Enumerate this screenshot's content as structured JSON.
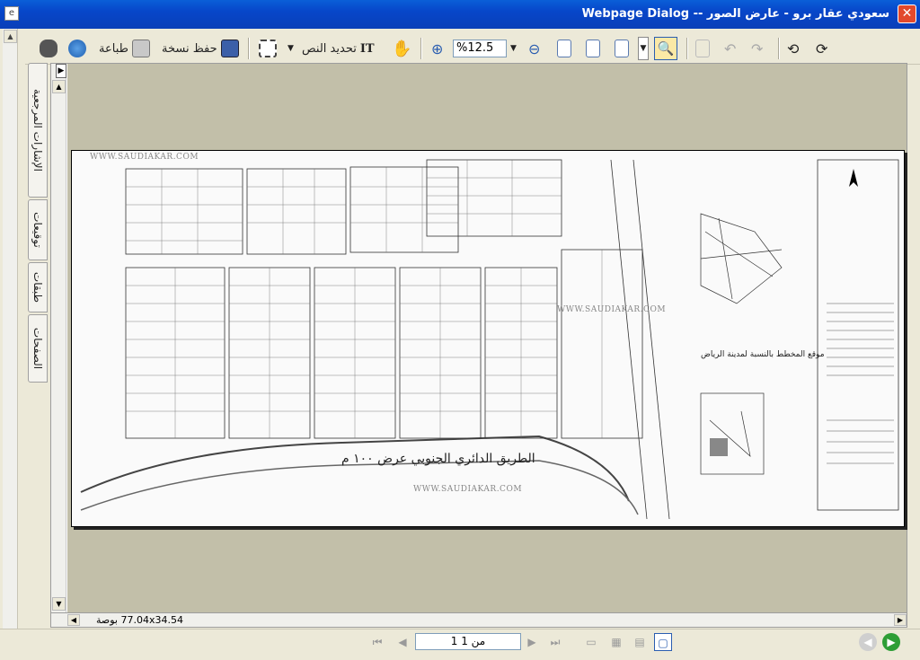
{
  "window": {
    "title": "سعودي عقار برو - عارض الصور -- Webpage Dialog",
    "close_label": "✕"
  },
  "toolbar": {
    "print_label": "طباعة",
    "save_copy_label": "حفظ نسخة",
    "select_text_label": "تحديد النص",
    "zoom_value": "%12.5"
  },
  "side_tabs": [
    {
      "label": "الإشارات المرجعية"
    },
    {
      "label": "توقيعات"
    },
    {
      "label": "طبقات"
    },
    {
      "label": "الصفحات"
    }
  ],
  "document": {
    "watermark": "WWW.SAUDIAKAR.COM",
    "road_text": "الطريق الدائري الجنوبي عرض ١٠٠ م",
    "caption": "موقع المخطط بالنسبة لمدينة الرياض"
  },
  "status": {
    "page_size": "77.04x34.54 بوصة"
  },
  "navigation": {
    "page_indicator": "1 من 1"
  },
  "colors": {
    "titlebar": "#0a46c9",
    "frame": "#ece9d8",
    "canvas": "#c2bfa9"
  }
}
